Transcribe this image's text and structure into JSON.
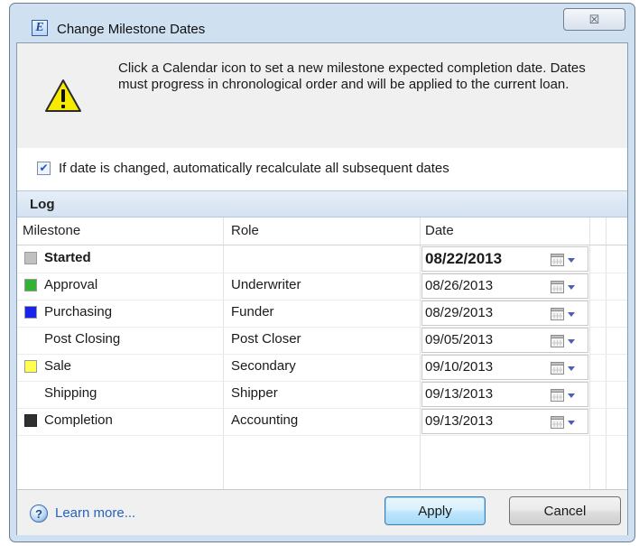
{
  "window": {
    "app_icon_letter": "E",
    "title": "Change Milestone Dates",
    "close_glyph": "☒"
  },
  "info": {
    "icon": "warning-icon",
    "message": "Click a Calendar icon to set a new milestone expected completion date. Dates must progress in chronological order and will be applied to the current loan."
  },
  "recalc": {
    "checked": true,
    "label": "If date is changed, automatically recalculate all subsequent dates"
  },
  "log": {
    "title": "Log",
    "columns": {
      "milestone": "Milestone",
      "role": "Role",
      "date": "Date"
    },
    "rows": [
      {
        "milestone": "Started",
        "role": "",
        "date": "08/22/2013",
        "color": "#c0c0c0",
        "bold": true
      },
      {
        "milestone": "Approval",
        "role": "Underwriter",
        "date": "08/26/2013",
        "color": "#33b333",
        "bold": false
      },
      {
        "milestone": "Purchasing",
        "role": "Funder",
        "date": "08/29/2013",
        "color": "#1a24e8",
        "bold": false
      },
      {
        "milestone": "Post Closing",
        "role": "Post Closer",
        "date": "09/05/2013",
        "color": "#ffffff",
        "bold": false
      },
      {
        "milestone": "Sale",
        "role": "Secondary",
        "date": "09/10/2013",
        "color": "#ffff4d",
        "bold": false
      },
      {
        "milestone": "Shipping",
        "role": "Shipper",
        "date": "09/13/2013",
        "color": "#ffffff",
        "bold": false
      },
      {
        "milestone": "Completion",
        "role": "Accounting",
        "date": "09/13/2013",
        "color": "#303030",
        "bold": false
      }
    ]
  },
  "footer": {
    "help_icon": "help-icon",
    "help_glyph": "?",
    "learn_more": "Learn more...",
    "apply_label": "Apply",
    "cancel_label": "Cancel"
  }
}
